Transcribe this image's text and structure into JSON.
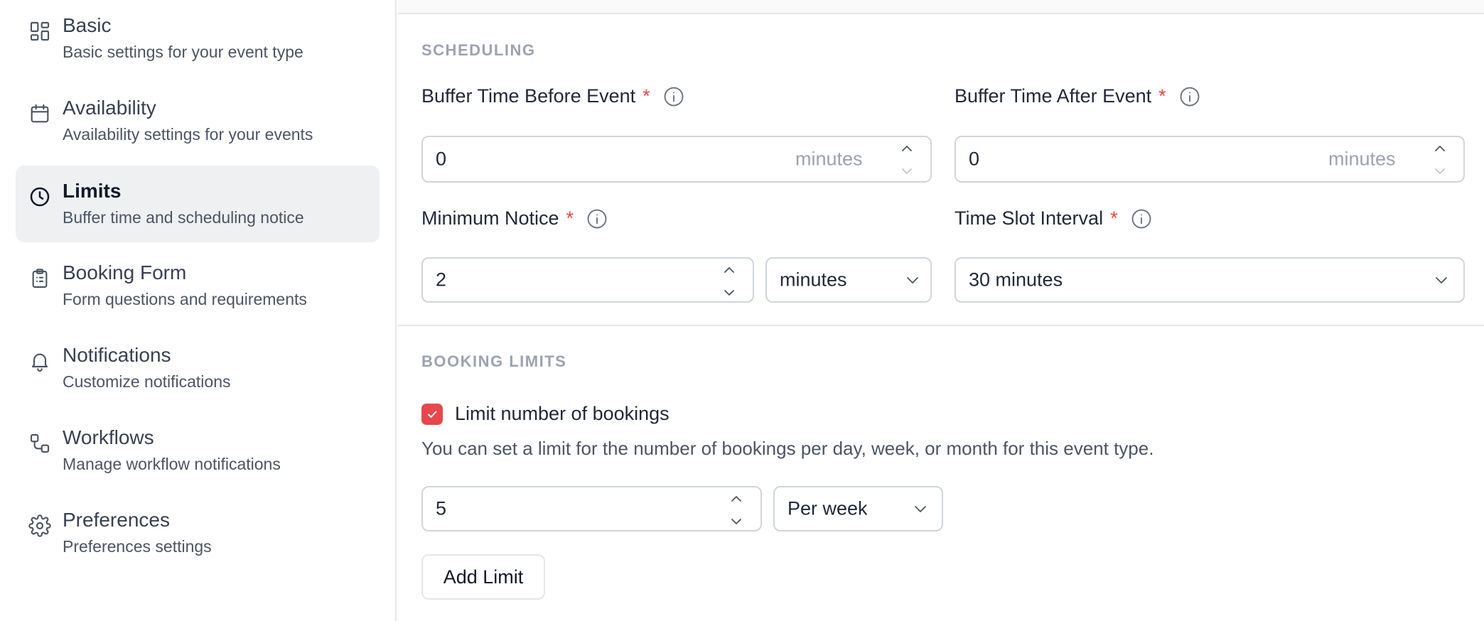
{
  "sidebar": {
    "items": [
      {
        "title": "Basic",
        "subtitle": "Basic settings for your event type",
        "icon": "grid-icon",
        "active": false
      },
      {
        "title": "Availability",
        "subtitle": "Availability settings for your events",
        "icon": "calendar-icon",
        "active": false
      },
      {
        "title": "Limits",
        "subtitle": "Buffer time and scheduling notice",
        "icon": "clock-icon",
        "active": true
      },
      {
        "title": "Booking Form",
        "subtitle": "Form questions and requirements",
        "icon": "clipboard-icon",
        "active": false
      },
      {
        "title": "Notifications",
        "subtitle": "Customize notifications",
        "icon": "bell-icon",
        "active": false
      },
      {
        "title": "Workflows",
        "subtitle": "Manage workflow notifications",
        "icon": "workflow-icon",
        "active": false
      },
      {
        "title": "Preferences",
        "subtitle": "Preferences settings",
        "icon": "gear-icon",
        "active": false
      }
    ]
  },
  "scheduling": {
    "section_title": "SCHEDULING",
    "buffer_before": {
      "label": "Buffer Time Before Event",
      "required": "*",
      "value": "0",
      "suffix": "minutes"
    },
    "buffer_after": {
      "label": "Buffer Time After Event",
      "required": "*",
      "value": "0",
      "suffix": "minutes"
    },
    "minimum_notice": {
      "label": "Minimum Notice",
      "required": "*",
      "value": "2",
      "unit": "minutes"
    },
    "time_slot_interval": {
      "label": "Time Slot Interval",
      "required": "*",
      "value": "30 minutes"
    }
  },
  "booking_limits": {
    "section_title": "BOOKING LIMITS",
    "checkbox_label": "Limit number of bookings",
    "checked": true,
    "help_text": "You can set a limit for the number of bookings per day, week, or month for this event type.",
    "limit_value": "5",
    "limit_period": "Per week",
    "add_button": "Add Limit"
  },
  "colors": {
    "accent": "#e5484d",
    "required": "#ef4444",
    "active_bg": "#eef0f2"
  }
}
